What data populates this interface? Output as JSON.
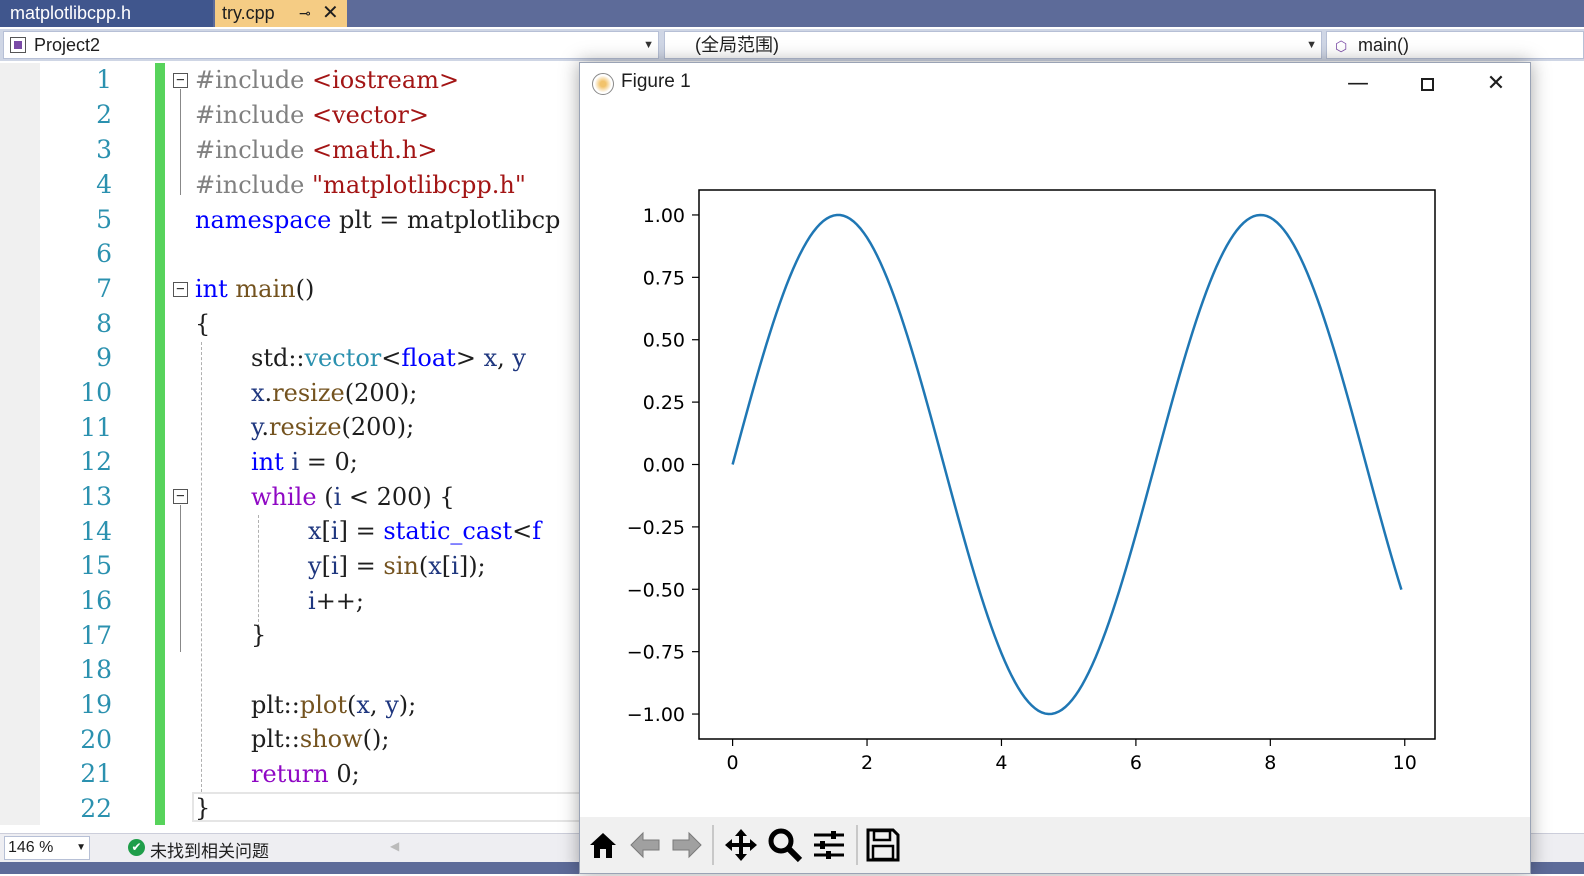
{
  "tabs": [
    {
      "label": "matplotlibcpp.h"
    },
    {
      "label": "try.cpp",
      "pin": "⊸",
      "close": "✕"
    }
  ],
  "navbar": {
    "project": "Project2",
    "scope": "(全局范围)",
    "member": "main()"
  },
  "line_numbers": [
    "1",
    "2",
    "3",
    "4",
    "5",
    "6",
    "7",
    "8",
    "9",
    "10",
    "11",
    "12",
    "13",
    "14",
    "15",
    "16",
    "17",
    "18",
    "19",
    "20",
    "21",
    "22"
  ],
  "code": {
    "l1": {
      "a": "#include ",
      "b": "<iostream>"
    },
    "l2": {
      "a": "#include ",
      "b": "<vector>"
    },
    "l3": {
      "a": "#include ",
      "b": "<math.h>"
    },
    "l4": {
      "a": "#include ",
      "b": "\"matplotlibcpp.h\""
    },
    "l5": {
      "a": "namespace",
      "b": " plt = matplotlibcp"
    },
    "l7": {
      "a": "int",
      "b": " ",
      "c": "main",
      "d": "()"
    },
    "l8": "{",
    "l9": {
      "a": "std::",
      "b": "vector",
      "c": "<",
      "d": "float",
      "e": "> ",
      "f": "x",
      "g": ", ",
      "h": "y"
    },
    "l10": {
      "a": "x",
      "b": ".",
      "c": "resize",
      "d": "(200);"
    },
    "l11": {
      "a": "y",
      "b": ".",
      "c": "resize",
      "d": "(200);"
    },
    "l12": {
      "a": "int",
      "b": " ",
      "c": "i",
      "d": " = 0;"
    },
    "l13": {
      "a": "while",
      "b": " (",
      "c": "i",
      "d": " < 200) {"
    },
    "l14": {
      "a": "x",
      "b": "[",
      "c": "i",
      "d": "]",
      "e": " = ",
      "f": "static_cast",
      "g": "<",
      "h": "f"
    },
    "l15": {
      "a": "y",
      "b": "[",
      "c": "i",
      "d": "]",
      "e": " = ",
      "f": "sin",
      "g": "(",
      "h": "x",
      "i": "[",
      "j": "i",
      "k": "]",
      "l": ");"
    },
    "l16": {
      "a": "i",
      "b": "++;"
    },
    "l17": "}",
    "l19": {
      "a": "plt::",
      "b": "plot",
      "c": "(",
      "d": "x",
      "e": ", ",
      "f": "y",
      "g": ");"
    },
    "l20": {
      "a": "plt::",
      "b": "show",
      "c": "();"
    },
    "l21": {
      "a": "return",
      "b": " 0;"
    },
    "l22": "}"
  },
  "statusbar": {
    "zoom": "146 %",
    "ok_mark": "✔",
    "issues": "未找到相关问题"
  },
  "figure": {
    "title": "Figure 1",
    "min": "—",
    "close": "✕"
  },
  "toolbar_icons": [
    "home-icon",
    "back-arrow-icon",
    "forward-arrow-icon",
    "pan-move-icon",
    "zoom-magnifier-icon",
    "configure-subplots-icon",
    "save-floppy-icon"
  ],
  "chart_data": {
    "type": "line",
    "title": "",
    "xlabel": "",
    "ylabel": "",
    "xlim": [
      -0.5,
      10.45
    ],
    "ylim": [
      -1.1,
      1.1
    ],
    "xticks": [
      "0",
      "2",
      "4",
      "6",
      "8",
      "10"
    ],
    "yticks": [
      "1.00",
      "0.75",
      "0.50",
      "0.25",
      "0.00",
      "−0.25",
      "−0.50",
      "−0.75",
      "−1.00"
    ],
    "series": [
      {
        "function": "y = sin(x)",
        "x_start": 0,
        "x_end": 9.95,
        "n_points": 200,
        "color": "#1f77b4"
      }
    ],
    "grid": false
  }
}
